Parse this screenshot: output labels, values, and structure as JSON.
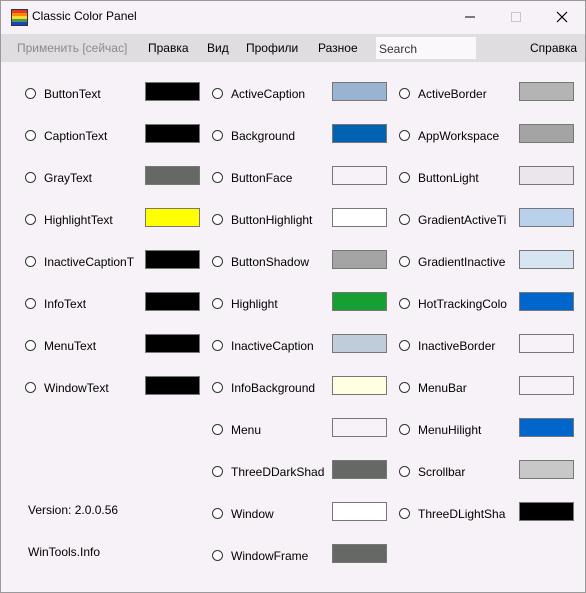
{
  "window": {
    "title": "Classic Color Panel"
  },
  "menu": {
    "apply": "Применить [сейчас]",
    "edit": "Правка",
    "view": "Вид",
    "profiles": "Профили",
    "misc": "Разное",
    "search_value": "Search",
    "help": "Справка"
  },
  "columns": [
    [
      {
        "label": "ButtonText",
        "color": "#000000"
      },
      {
        "label": "CaptionText",
        "color": "#000000"
      },
      {
        "label": "GrayText",
        "color": "#666866"
      },
      {
        "label": "HighlightText",
        "color": "#ffff00"
      },
      {
        "label": "InactiveCaptionT",
        "color": "#000000"
      },
      {
        "label": "InfoText",
        "color": "#000000"
      },
      {
        "label": "MenuText",
        "color": "#000000"
      },
      {
        "label": "WindowText",
        "color": "#000000"
      }
    ],
    [
      {
        "label": "ActiveCaption",
        "color": "#99b4d1"
      },
      {
        "label": "Background",
        "color": "#0063b1"
      },
      {
        "label": "ButtonFace",
        "color": "#f7f2f7"
      },
      {
        "label": "ButtonHighlight",
        "color": "#ffffff"
      },
      {
        "label": "ButtonShadow",
        "color": "#a5a4a5"
      },
      {
        "label": "Highlight",
        "color": "#16a034"
      },
      {
        "label": "InactiveCaption",
        "color": "#bfcddb"
      },
      {
        "label": "InfoBackground",
        "color": "#ffffe1"
      },
      {
        "label": "Menu",
        "color": "#f7f2f7"
      },
      {
        "label": "ThreeDDarkShad",
        "color": "#666866"
      },
      {
        "label": "Window",
        "color": "#ffffff"
      },
      {
        "label": "WindowFrame",
        "color": "#666866"
      }
    ],
    [
      {
        "label": "ActiveBorder",
        "color": "#b4b4b4"
      },
      {
        "label": "AppWorkspace",
        "color": "#a5a4a5"
      },
      {
        "label": "ButtonLight",
        "color": "#ebe6eb"
      },
      {
        "label": "GradientActiveTi",
        "color": "#b9d1ea"
      },
      {
        "label": "GradientInactive",
        "color": "#d7e4f2"
      },
      {
        "label": "HotTrackingColo",
        "color": "#0066cc"
      },
      {
        "label": "InactiveBorder",
        "color": "#f7f2f7"
      },
      {
        "label": "MenuBar",
        "color": "#f7f2f7"
      },
      {
        "label": "MenuHilight",
        "color": "#0066cc"
      },
      {
        "label": "Scrollbar",
        "color": "#c8c8c8"
      },
      {
        "label": "ThreeDLightSha",
        "color": "#000000"
      }
    ]
  ],
  "footer": {
    "version": "Version: 2.0.0.56",
    "site": "WinTools.Info"
  }
}
